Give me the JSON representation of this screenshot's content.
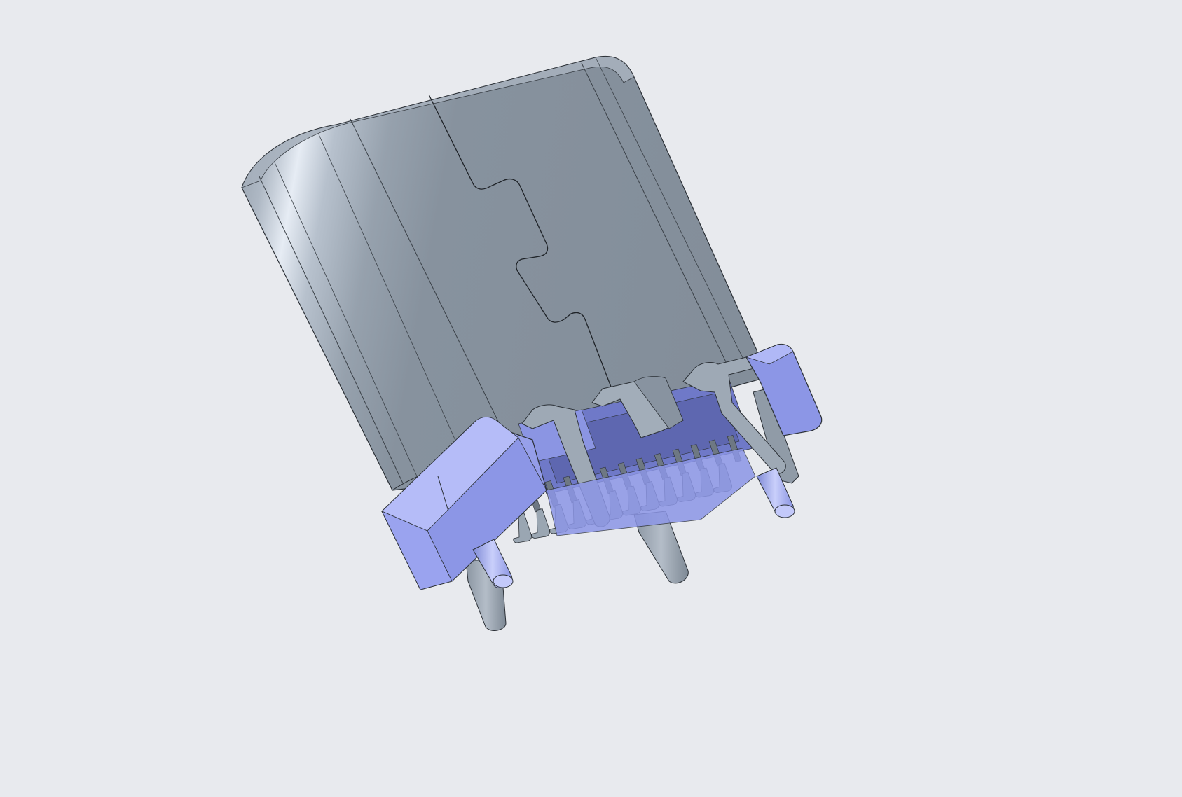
{
  "scene": {
    "subject": "usb-c-receptacle-3d-model",
    "colors": {
      "background": "#e8eaee",
      "shell_dark": "#838e9a",
      "shell_light": "#c9d2dd",
      "shell_edge": "#2b3036",
      "housing_blue": "#8c96e6",
      "housing_light": "#a9b1f4",
      "housing_dark": "#6a74c4",
      "metal_pin": "#9aa6b2",
      "metal_pin_dark": "#6e7883"
    },
    "pin_count_visible": 12,
    "through_hole_legs": 4,
    "mounting_posts": 2
  }
}
